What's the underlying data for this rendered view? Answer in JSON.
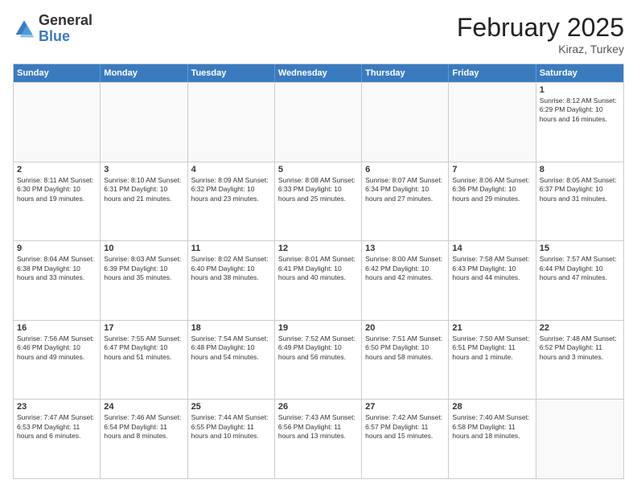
{
  "logo": {
    "general": "General",
    "blue": "Blue"
  },
  "header": {
    "month": "February 2025",
    "location": "Kiraz, Turkey"
  },
  "weekdays": [
    "Sunday",
    "Monday",
    "Tuesday",
    "Wednesday",
    "Thursday",
    "Friday",
    "Saturday"
  ],
  "rows": [
    [
      {
        "day": "",
        "info": ""
      },
      {
        "day": "",
        "info": ""
      },
      {
        "day": "",
        "info": ""
      },
      {
        "day": "",
        "info": ""
      },
      {
        "day": "",
        "info": ""
      },
      {
        "day": "",
        "info": ""
      },
      {
        "day": "1",
        "info": "Sunrise: 8:12 AM\nSunset: 6:29 PM\nDaylight: 10 hours\nand 16 minutes."
      }
    ],
    [
      {
        "day": "2",
        "info": "Sunrise: 8:11 AM\nSunset: 6:30 PM\nDaylight: 10 hours\nand 19 minutes."
      },
      {
        "day": "3",
        "info": "Sunrise: 8:10 AM\nSunset: 6:31 PM\nDaylight: 10 hours\nand 21 minutes."
      },
      {
        "day": "4",
        "info": "Sunrise: 8:09 AM\nSunset: 6:32 PM\nDaylight: 10 hours\nand 23 minutes."
      },
      {
        "day": "5",
        "info": "Sunrise: 8:08 AM\nSunset: 6:33 PM\nDaylight: 10 hours\nand 25 minutes."
      },
      {
        "day": "6",
        "info": "Sunrise: 8:07 AM\nSunset: 6:34 PM\nDaylight: 10 hours\nand 27 minutes."
      },
      {
        "day": "7",
        "info": "Sunrise: 8:06 AM\nSunset: 6:36 PM\nDaylight: 10 hours\nand 29 minutes."
      },
      {
        "day": "8",
        "info": "Sunrise: 8:05 AM\nSunset: 6:37 PM\nDaylight: 10 hours\nand 31 minutes."
      }
    ],
    [
      {
        "day": "9",
        "info": "Sunrise: 8:04 AM\nSunset: 6:38 PM\nDaylight: 10 hours\nand 33 minutes."
      },
      {
        "day": "10",
        "info": "Sunrise: 8:03 AM\nSunset: 6:39 PM\nDaylight: 10 hours\nand 35 minutes."
      },
      {
        "day": "11",
        "info": "Sunrise: 8:02 AM\nSunset: 6:40 PM\nDaylight: 10 hours\nand 38 minutes."
      },
      {
        "day": "12",
        "info": "Sunrise: 8:01 AM\nSunset: 6:41 PM\nDaylight: 10 hours\nand 40 minutes."
      },
      {
        "day": "13",
        "info": "Sunrise: 8:00 AM\nSunset: 6:42 PM\nDaylight: 10 hours\nand 42 minutes."
      },
      {
        "day": "14",
        "info": "Sunrise: 7:58 AM\nSunset: 6:43 PM\nDaylight: 10 hours\nand 44 minutes."
      },
      {
        "day": "15",
        "info": "Sunrise: 7:57 AM\nSunset: 6:44 PM\nDaylight: 10 hours\nand 47 minutes."
      }
    ],
    [
      {
        "day": "16",
        "info": "Sunrise: 7:56 AM\nSunset: 6:46 PM\nDaylight: 10 hours\nand 49 minutes."
      },
      {
        "day": "17",
        "info": "Sunrise: 7:55 AM\nSunset: 6:47 PM\nDaylight: 10 hours\nand 51 minutes."
      },
      {
        "day": "18",
        "info": "Sunrise: 7:54 AM\nSunset: 6:48 PM\nDaylight: 10 hours\nand 54 minutes."
      },
      {
        "day": "19",
        "info": "Sunrise: 7:52 AM\nSunset: 6:49 PM\nDaylight: 10 hours\nand 56 minutes."
      },
      {
        "day": "20",
        "info": "Sunrise: 7:51 AM\nSunset: 6:50 PM\nDaylight: 10 hours\nand 58 minutes."
      },
      {
        "day": "21",
        "info": "Sunrise: 7:50 AM\nSunset: 6:51 PM\nDaylight: 11 hours\nand 1 minute."
      },
      {
        "day": "22",
        "info": "Sunrise: 7:48 AM\nSunset: 6:52 PM\nDaylight: 11 hours\nand 3 minutes."
      }
    ],
    [
      {
        "day": "23",
        "info": "Sunrise: 7:47 AM\nSunset: 6:53 PM\nDaylight: 11 hours\nand 6 minutes."
      },
      {
        "day": "24",
        "info": "Sunrise: 7:46 AM\nSunset: 6:54 PM\nDaylight: 11 hours\nand 8 minutes."
      },
      {
        "day": "25",
        "info": "Sunrise: 7:44 AM\nSunset: 6:55 PM\nDaylight: 11 hours\nand 10 minutes."
      },
      {
        "day": "26",
        "info": "Sunrise: 7:43 AM\nSunset: 6:56 PM\nDaylight: 11 hours\nand 13 minutes."
      },
      {
        "day": "27",
        "info": "Sunrise: 7:42 AM\nSunset: 6:57 PM\nDaylight: 11 hours\nand 15 minutes."
      },
      {
        "day": "28",
        "info": "Sunrise: 7:40 AM\nSunset: 6:58 PM\nDaylight: 11 hours\nand 18 minutes."
      },
      {
        "day": "",
        "info": ""
      }
    ]
  ]
}
